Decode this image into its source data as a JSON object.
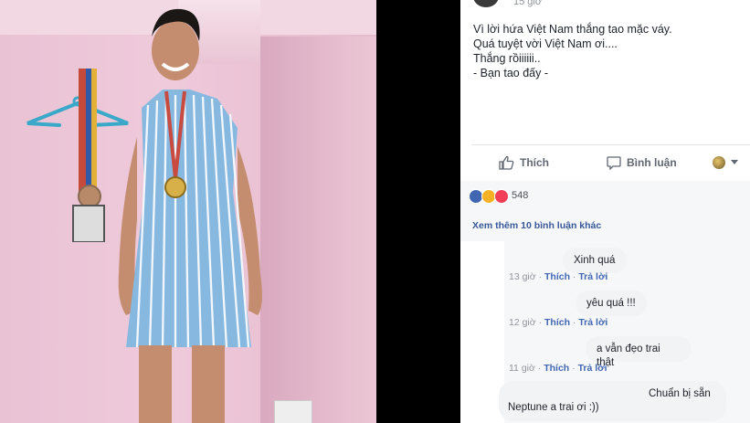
{
  "post": {
    "time": "15 giờ",
    "text_lines": [
      "Vì lời hứa Việt Nam thắng tao mặc váy.",
      "Quá tuyệt vời Việt Nam ơi....",
      "Thắng rồiiiiii..",
      "- Bạn tao đấy -"
    ]
  },
  "actions": {
    "like": "Thích",
    "comment": "Bình luận"
  },
  "reactions": {
    "count": "548",
    "types": [
      "like-icon",
      "haha-icon",
      "love-icon"
    ]
  },
  "comments_link": "Xem thêm 10 bình luận khác",
  "comments": [
    {
      "text": "Xinh quá",
      "time": "13 giờ",
      "like": "Thích",
      "reply": "Trả lời"
    },
    {
      "text": "yêu quá !!!",
      "time": "12 giờ",
      "like": "Thích",
      "reply": "Trả lời"
    },
    {
      "text": "a vẫn đẹo trai thật",
      "time": "11 giờ",
      "like": "Thích",
      "reply": "Trả lời"
    },
    {
      "text_line1": "Chuẩn bị sẵn",
      "text_line2": "Neptune a trai ơi :))"
    }
  ],
  "colors": {
    "link": "#385898",
    "like_blue": "#4267b2",
    "love_red": "#f33e58",
    "haha_yellow": "#f7b125"
  }
}
